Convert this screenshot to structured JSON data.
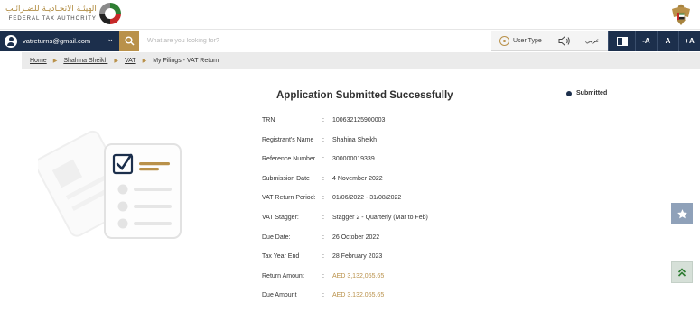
{
  "header": {
    "logo_arabic": "الهيئـة الاتحـاديـة للضـرائـب",
    "logo_english": "FEDERAL TAX AUTHORITY",
    "logo_icon": "fta-logo-icon",
    "emblem_icon": "uae-emblem-icon"
  },
  "navbar": {
    "account_email": "vatreturns@gmail.com",
    "search_placeholder": "What are you looking for?",
    "user_type_label": "User Type",
    "language_label": "عربي",
    "decrease_font_label": "-A",
    "normal_font_label": "A",
    "increase_font_label": "+A"
  },
  "breadcrumb": {
    "items": [
      "Home",
      "Shahina Sheikh",
      "VAT"
    ],
    "current": "My Filings - VAT Return"
  },
  "main": {
    "title": "Application Submitted Successfully",
    "status": "Submitted",
    "details": [
      {
        "label": "TRN",
        "value": "100632125900003"
      },
      {
        "label": "Registrant's Name",
        "value": "Shahina Sheikh"
      },
      {
        "label": "Reference Number",
        "value": "300000019339"
      },
      {
        "label": "Submission Date",
        "value": "4 November 2022"
      },
      {
        "label": "VAT Return Period:",
        "value": "01/06/2022 - 31/08/2022"
      },
      {
        "label": "VAT Stagger:",
        "value": "Stagger 2 - Quarterly (Mar to Feb)"
      },
      {
        "label": "Due Date:",
        "value": "26 October 2022"
      },
      {
        "label": "Tax Year End",
        "value": "28 February 2023"
      },
      {
        "label": "Return Amount",
        "value": "AED 3,132,055.65"
      },
      {
        "label": "Due Amount",
        "value": "AED 3,132,055.65"
      }
    ]
  },
  "colors": {
    "navy": "#1c2f4c",
    "gold": "#b9914a"
  }
}
